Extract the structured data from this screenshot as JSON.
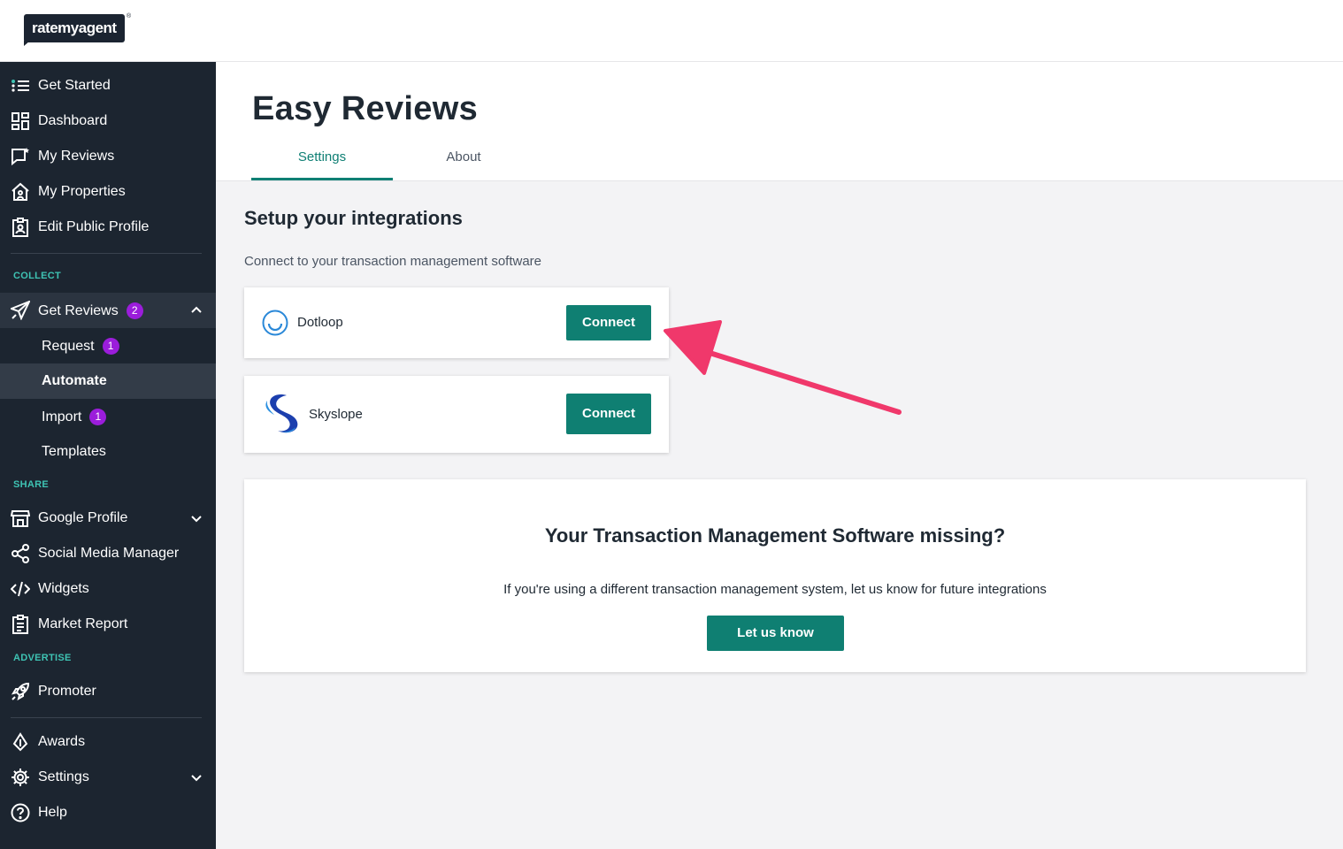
{
  "brand": {
    "logo_text": "ratemyagent",
    "reg_mark": "®"
  },
  "sidebar": {
    "main_items": [
      {
        "label": "Get Started",
        "icon": "list-icon"
      },
      {
        "label": "Dashboard",
        "icon": "dashboard-icon"
      },
      {
        "label": "My Reviews",
        "icon": "chat-star-icon"
      },
      {
        "label": "My Properties",
        "icon": "house-icon"
      },
      {
        "label": "Edit Public Profile",
        "icon": "id-badge-icon"
      }
    ],
    "collect": {
      "heading": "COLLECT",
      "get_reviews": {
        "label": "Get Reviews",
        "badge": "2",
        "icon": "paper-plane-icon"
      },
      "sub_items": [
        {
          "label": "Request",
          "badge": "1"
        },
        {
          "label": "Automate"
        },
        {
          "label": "Import",
          "badge": "1"
        },
        {
          "label": "Templates"
        }
      ]
    },
    "share": {
      "heading": "SHARE",
      "items": [
        {
          "label": "Google Profile",
          "icon": "storefront-icon"
        },
        {
          "label": "Social Media Manager",
          "icon": "share-icon"
        },
        {
          "label": "Widgets",
          "icon": "code-icon"
        },
        {
          "label": "Market Report",
          "icon": "report-icon"
        }
      ]
    },
    "advertise": {
      "heading": "ADVERTISE",
      "items": [
        {
          "label": "Promoter",
          "icon": "rocket-icon"
        }
      ]
    },
    "bottom_items": [
      {
        "label": "Awards",
        "icon": "award-icon"
      },
      {
        "label": "Settings",
        "icon": "gear-icon"
      },
      {
        "label": "Help",
        "icon": "help-icon"
      }
    ]
  },
  "page": {
    "title": "Easy Reviews",
    "tabs": [
      {
        "label": "Settings"
      },
      {
        "label": "About"
      }
    ]
  },
  "integrations": {
    "title": "Setup your integrations",
    "subtitle": "Connect to your transaction management software",
    "cards": [
      {
        "name": "Dotloop",
        "button": "Connect"
      },
      {
        "name": "Skyslope",
        "button": "Connect"
      }
    ]
  },
  "missing": {
    "title": "Your Transaction Management Software missing?",
    "text": "If you're using a different transaction management system, let us know for future integrations",
    "button": "Let us know"
  },
  "colors": {
    "accent": "#0f7f72",
    "sidebar_bg": "#1c2530",
    "badge": "#9b1ddb",
    "section_head": "#3ec3b3",
    "annotation_arrow": "#f0386b"
  }
}
